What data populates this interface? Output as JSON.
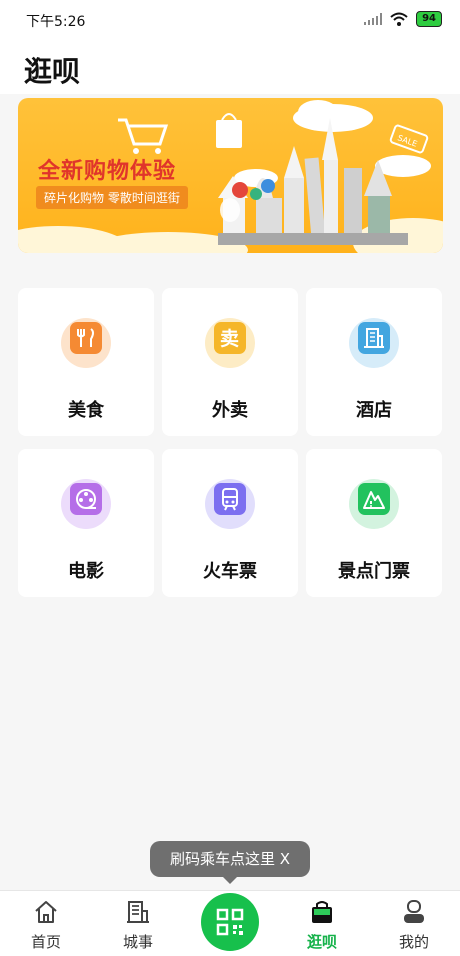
{
  "status_bar": {
    "time": "下午5:26",
    "battery": "94"
  },
  "header": {
    "title": "逛呗"
  },
  "banner": {
    "title": "全新购物体验",
    "subtitle": "碎片化购物 零散时间逛街",
    "sale_tag": "SALE"
  },
  "grid": {
    "items": [
      {
        "label": "美食",
        "icon": "utensils-icon",
        "color": "#f58a33",
        "halo": "#fde3cb"
      },
      {
        "label": "外卖",
        "icon": "takeaway-icon",
        "color": "#f5b62a",
        "halo": "#fdecc5"
      },
      {
        "label": "酒店",
        "icon": "hotel-icon",
        "color": "#43a6e0",
        "halo": "#d6ecf9"
      },
      {
        "label": "电影",
        "icon": "film-reel-icon",
        "color": "#b56ee8",
        "halo": "#ecdcfb"
      },
      {
        "label": "火车票",
        "icon": "train-icon",
        "color": "#7c6ff0",
        "halo": "#e1defc"
      },
      {
        "label": "景点门票",
        "icon": "mountain-ticket-icon",
        "color": "#22c25e",
        "halo": "#d3f3df"
      }
    ]
  },
  "tooltip": {
    "text": "刷码乘车点这里 X"
  },
  "tabbar": {
    "tabs": [
      {
        "label": "首页",
        "icon": "home-icon"
      },
      {
        "label": "城事",
        "icon": "city-building-icon"
      },
      {
        "label": "",
        "icon": "qr-scan-icon"
      },
      {
        "label": "逛呗",
        "icon": "shopping-bag-icon",
        "active": true
      },
      {
        "label": "我的",
        "icon": "profile-icon"
      }
    ],
    "accent": "#15b24a"
  }
}
